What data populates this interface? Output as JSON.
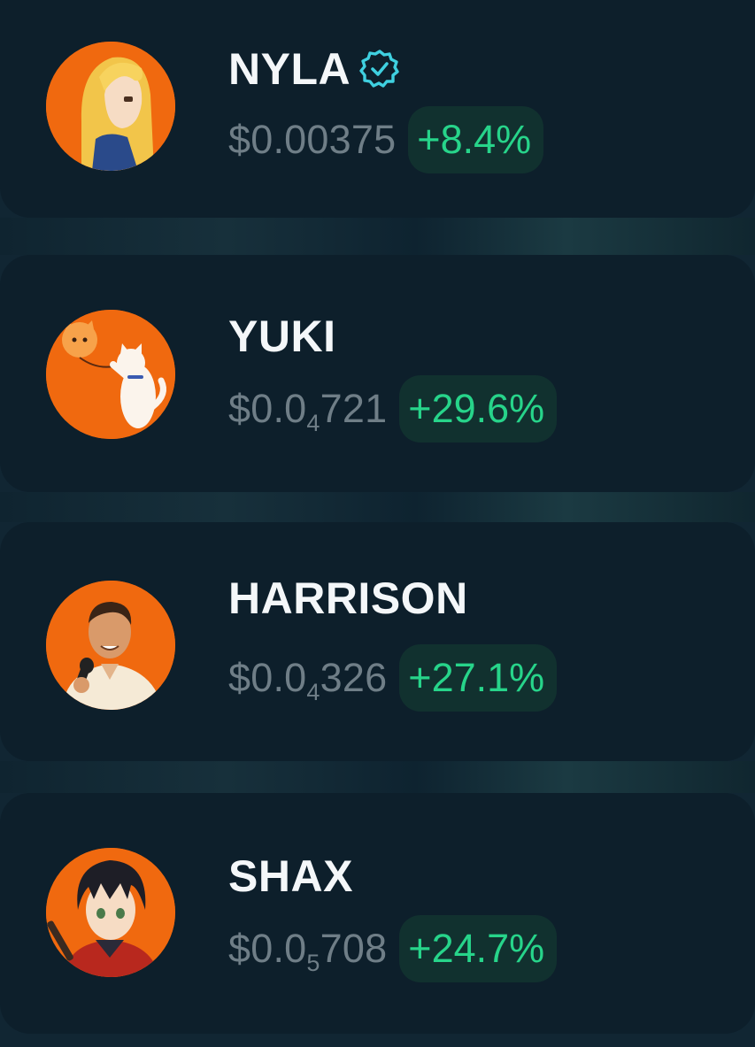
{
  "tokens": [
    {
      "name": "NYLA",
      "verified": true,
      "price_prefix": "$0.00375",
      "price_zeros": "",
      "price_suffix": "",
      "change": "+8.4%",
      "avatar_icon": "anime-girl-avatar-icon"
    },
    {
      "name": "YUKI",
      "verified": false,
      "price_prefix": "$0.0",
      "price_zeros": "4",
      "price_suffix": "721",
      "change": "+29.6%",
      "avatar_icon": "cat-balloon-avatar-icon"
    },
    {
      "name": "HARRISON",
      "verified": false,
      "price_prefix": "$0.0",
      "price_zeros": "4",
      "price_suffix": "326",
      "change": "+27.1%",
      "avatar_icon": "man-microphone-avatar-icon"
    },
    {
      "name": "SHAX",
      "verified": false,
      "price_prefix": "$0.0",
      "price_zeros": "5",
      "price_suffix": "708",
      "change": "+24.7%",
      "avatar_icon": "anime-boy-avatar-icon"
    }
  ],
  "colors": {
    "background": "#0d1f2b",
    "avatar_bg": "#f0690f",
    "name": "#f4f7f9",
    "price": "#6f7e87",
    "change_text": "#27d48a",
    "change_bg": "#11312f",
    "verified": "#3fd0e0"
  }
}
